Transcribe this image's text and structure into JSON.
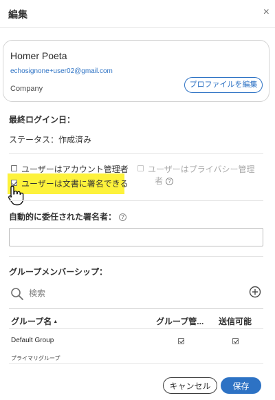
{
  "dialog": {
    "title": "編集",
    "close_glyph": "×"
  },
  "profile": {
    "name": "Homer Poeta",
    "email": "echosignone+user02@gmail.com",
    "company": "Company",
    "edit_button": "プロファイルを編集"
  },
  "info": {
    "last_login": "最終ログイン日：",
    "status": "ステータス：作成済み"
  },
  "permissions": {
    "account_admin": {
      "label": "ユーザーはアカウント管理者",
      "checked": false
    },
    "can_sign": {
      "label": "ユーザーは文書に署名できる",
      "checked": true
    },
    "privacy_admin": {
      "label": "ユーザーはプライバシー管理",
      "label2": "者",
      "checked": false,
      "disabled": true
    }
  },
  "delegation": {
    "label": "自動的に委任された署名者：",
    "value": ""
  },
  "groups": {
    "label": "グループメンバーシップ：",
    "search_placeholder": "検索",
    "columns": [
      "グループ名",
      "グループ管...",
      "送信可能"
    ],
    "rows": [
      {
        "name": "Default Group",
        "subtitle": "プライマリグループ",
        "group_admin": true,
        "can_send": true
      }
    ]
  },
  "footer": {
    "cancel": "キャンセル",
    "save": "保存"
  },
  "colors": {
    "accent": "#2d72c4",
    "highlight": "#fdf23b"
  }
}
